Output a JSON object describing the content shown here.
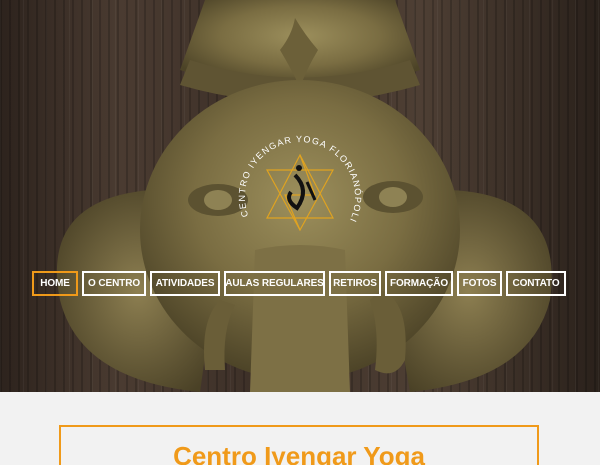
{
  "hero": {
    "logo_text": "CENTRO IYENGAR YOGA FLORIANÓPOLIS"
  },
  "nav": {
    "items": [
      {
        "label": "HOME",
        "active": true
      },
      {
        "label": "O CENTRO",
        "active": false
      },
      {
        "label": "ATIVIDADES",
        "active": false
      },
      {
        "label": "AULAS REGULARES",
        "active": false
      },
      {
        "label": "RETIROS",
        "active": false
      },
      {
        "label": "FORMAÇÃO",
        "active": false
      },
      {
        "label": "FOTOS",
        "active": false
      },
      {
        "label": "CONTATO",
        "active": false
      }
    ]
  },
  "content": {
    "title": "Centro Iyengar Yoga"
  },
  "colors": {
    "accent": "#f09a1a",
    "nav_text": "#ffffff",
    "background": "#f2f2f2"
  }
}
